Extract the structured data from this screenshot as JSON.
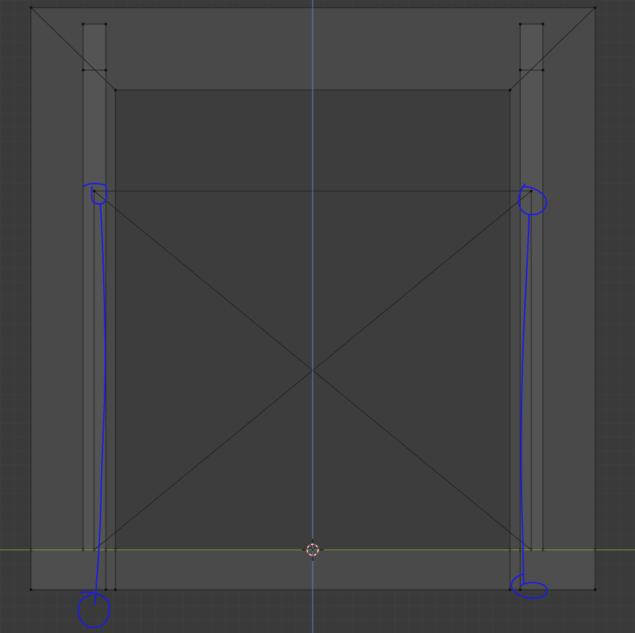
{
  "viewport": {
    "mode": "blender-3d-viewport-front-orthographic",
    "colors": {
      "background": "#3a3a3a",
      "grid_minor": "#414141",
      "grid_major": "#4a4a4a",
      "mesh_face_light": "#4a4a4a",
      "mesh_face_dark": "#3c3c3c",
      "mesh_edge": "#1e1e1e",
      "vertex": "#0f0f0f",
      "z_axis": "#5a8fcf",
      "x_axis": "#7aa83a",
      "annotation": "#1a1aee",
      "cursor_red": "#e23b3b",
      "cursor_white": "#ffffff"
    },
    "icons": [
      "3d-cursor-icon"
    ]
  }
}
